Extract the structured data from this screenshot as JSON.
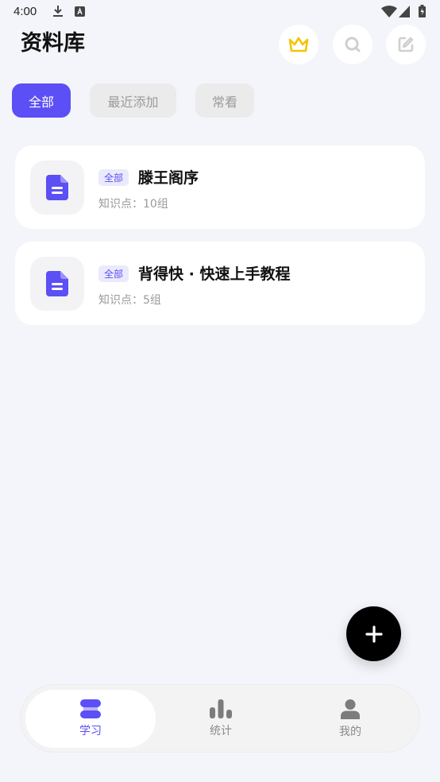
{
  "status_bar": {
    "time": "4:00"
  },
  "header": {
    "title": "资料库"
  },
  "filters": [
    {
      "label": "全部",
      "active": true
    },
    {
      "label": "最近添加",
      "active": false
    },
    {
      "label": "常看",
      "active": false
    }
  ],
  "cards": [
    {
      "tag": "全部",
      "title": "滕王阁序",
      "subtitle": "知识点：10组"
    },
    {
      "tag": "全部",
      "title": "背得快 · 快速上手教程",
      "subtitle": "知识点：5组"
    }
  ],
  "bottom_nav": [
    {
      "label": "学习",
      "icon": "study-icon",
      "active": true
    },
    {
      "label": "统计",
      "icon": "stats-icon",
      "active": false
    },
    {
      "label": "我的",
      "icon": "profile-icon",
      "active": false
    }
  ],
  "colors": {
    "accent": "#5b4ff5",
    "crown": "#f5c400",
    "background": "#f4f5fa"
  }
}
